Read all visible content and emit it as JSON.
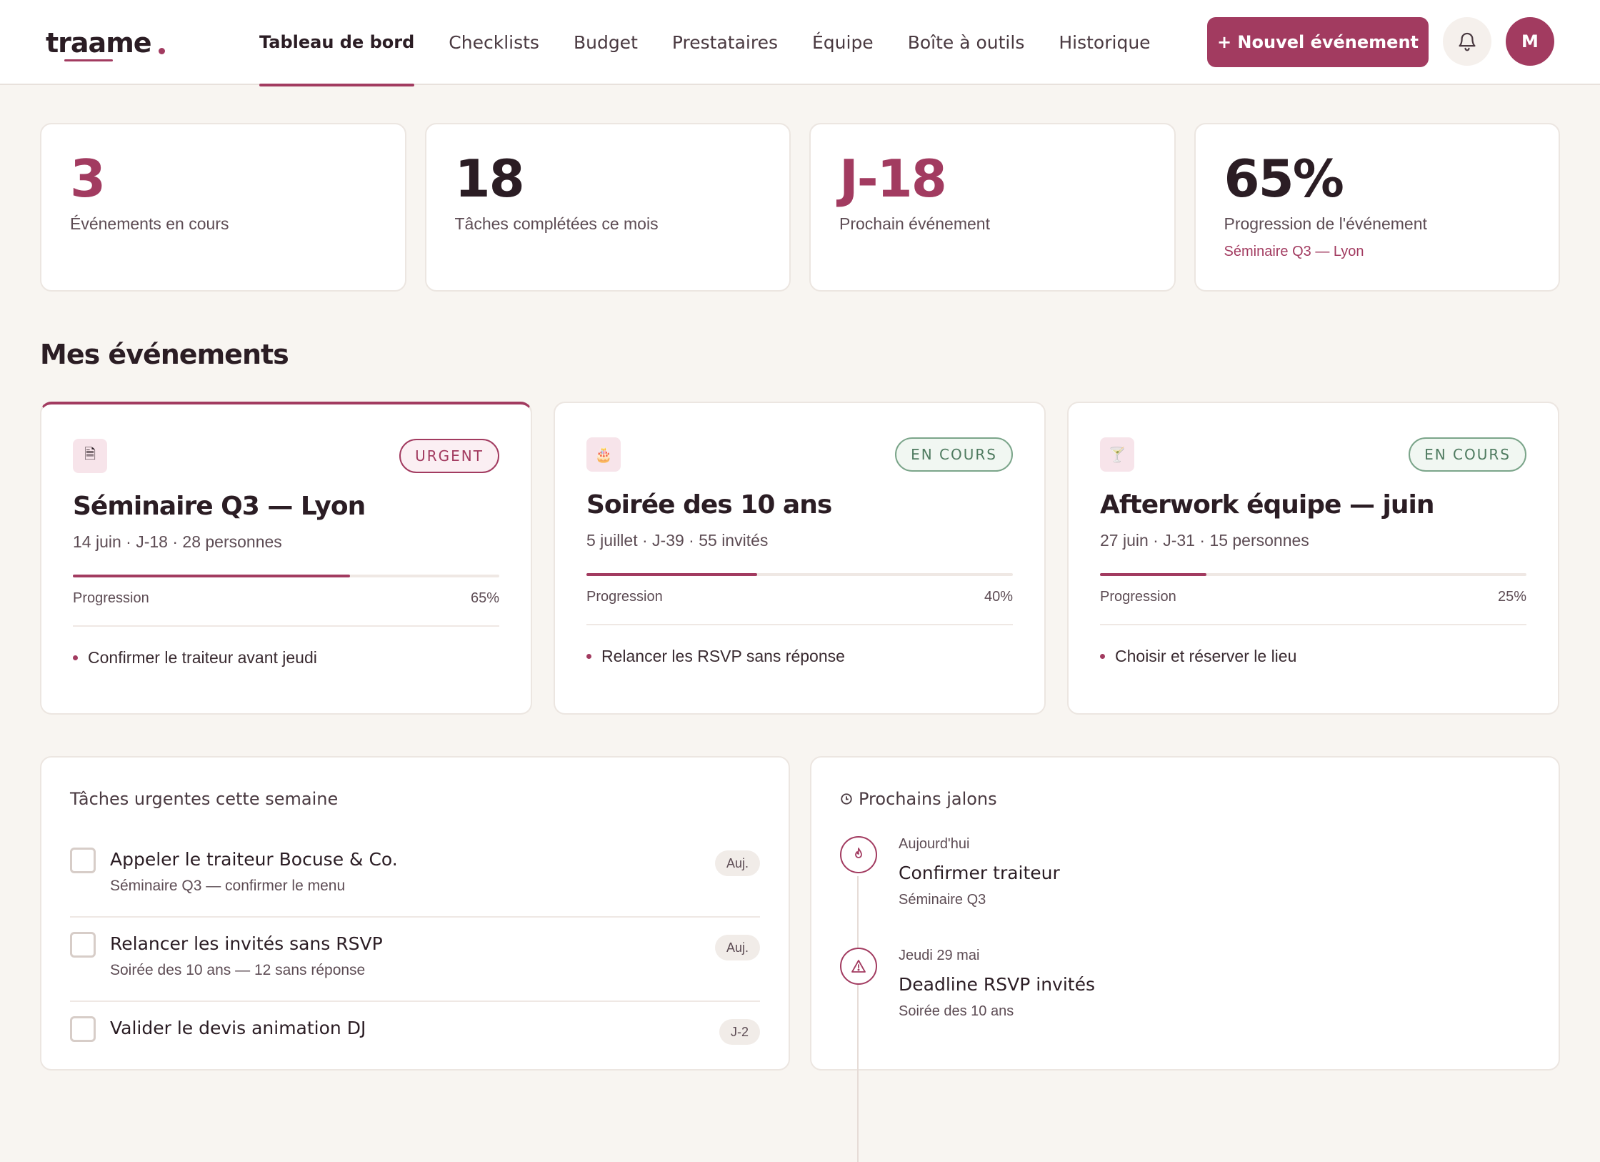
{
  "brand": {
    "name": "traame"
  },
  "nav": {
    "items": [
      {
        "label": "Tableau de bord",
        "active": true
      },
      {
        "label": "Checklists",
        "active": false
      },
      {
        "label": "Budget",
        "active": false
      },
      {
        "label": "Prestataires",
        "active": false
      },
      {
        "label": "Équipe",
        "active": false
      },
      {
        "label": "Boîte à outils",
        "active": false
      },
      {
        "label": "Historique",
        "active": false
      }
    ]
  },
  "header": {
    "new_event_label": "+ Nouvel événement",
    "notifications_icon": "bell-icon",
    "avatar_initial": "M"
  },
  "stats": [
    {
      "value": "3",
      "label": "Événements en cours",
      "sub": "",
      "accent": true
    },
    {
      "value": "18",
      "label": "Tâches complétées ce mois",
      "sub": "",
      "accent": false
    },
    {
      "value": "J-18",
      "label": "Prochain événement",
      "sub": "",
      "accent": true
    },
    {
      "value": "65%",
      "label": "Progression de l'événement",
      "sub": "Séminaire Q3 — Lyon",
      "accent": false
    }
  ],
  "events_section": {
    "title": "Mes événements",
    "progress_label": "Progression",
    "events": [
      {
        "icon": "document-icon",
        "icon_glyph": "🗎",
        "badge": "URGENT",
        "status": "urgent",
        "title": "Séminaire Q3 — Lyon",
        "meta": "14 juin · J-18 · 28 personnes",
        "progress": 0.65,
        "progress_text": "65%",
        "next_task": "Confirmer le traiteur avant jeudi"
      },
      {
        "icon": "cake-icon",
        "icon_glyph": "🎂",
        "badge": "EN COURS",
        "status": "in-progress",
        "title": "Soirée des 10 ans",
        "meta": "5 juillet · J-39 · 55 invités",
        "progress": 0.4,
        "progress_text": "40%",
        "next_task": "Relancer les RSVP sans réponse"
      },
      {
        "icon": "cocktail-icon",
        "icon_glyph": "🍸",
        "badge": "EN COURS",
        "status": "in-progress",
        "title": "Afterwork équipe — juin",
        "meta": "27 juin · J-31 · 15 personnes",
        "progress": 0.25,
        "progress_text": "25%",
        "next_task": "Choisir et réserver le lieu"
      }
    ]
  },
  "urgent_tasks": {
    "title": "Tâches urgentes cette semaine",
    "items": [
      {
        "title": "Appeler le traiteur Bocuse & Co.",
        "sub": "Séminaire Q3 — confirmer le menu",
        "due": "Auj."
      },
      {
        "title": "Relancer les invités sans RSVP",
        "sub": "Soirée des 10 ans — 12 sans réponse",
        "due": "Auj."
      },
      {
        "title": "Valider le devis animation DJ",
        "sub": "",
        "due": "J-2"
      }
    ]
  },
  "milestones": {
    "title": "Prochains jalons",
    "title_icon": "clock-icon",
    "items": [
      {
        "icon": "flame-icon",
        "date": "Aujourd'hui",
        "title": "Confirmer traiteur",
        "sub": "Séminaire Q3"
      },
      {
        "icon": "warning-icon",
        "date": "Jeudi 29 mai",
        "title": "Deadline RSVP invités",
        "sub": "Soirée des 10 ans"
      }
    ]
  },
  "colors": {
    "accent": "#a23b60",
    "success": "#4f7b60",
    "background": "#f8f5f1"
  }
}
